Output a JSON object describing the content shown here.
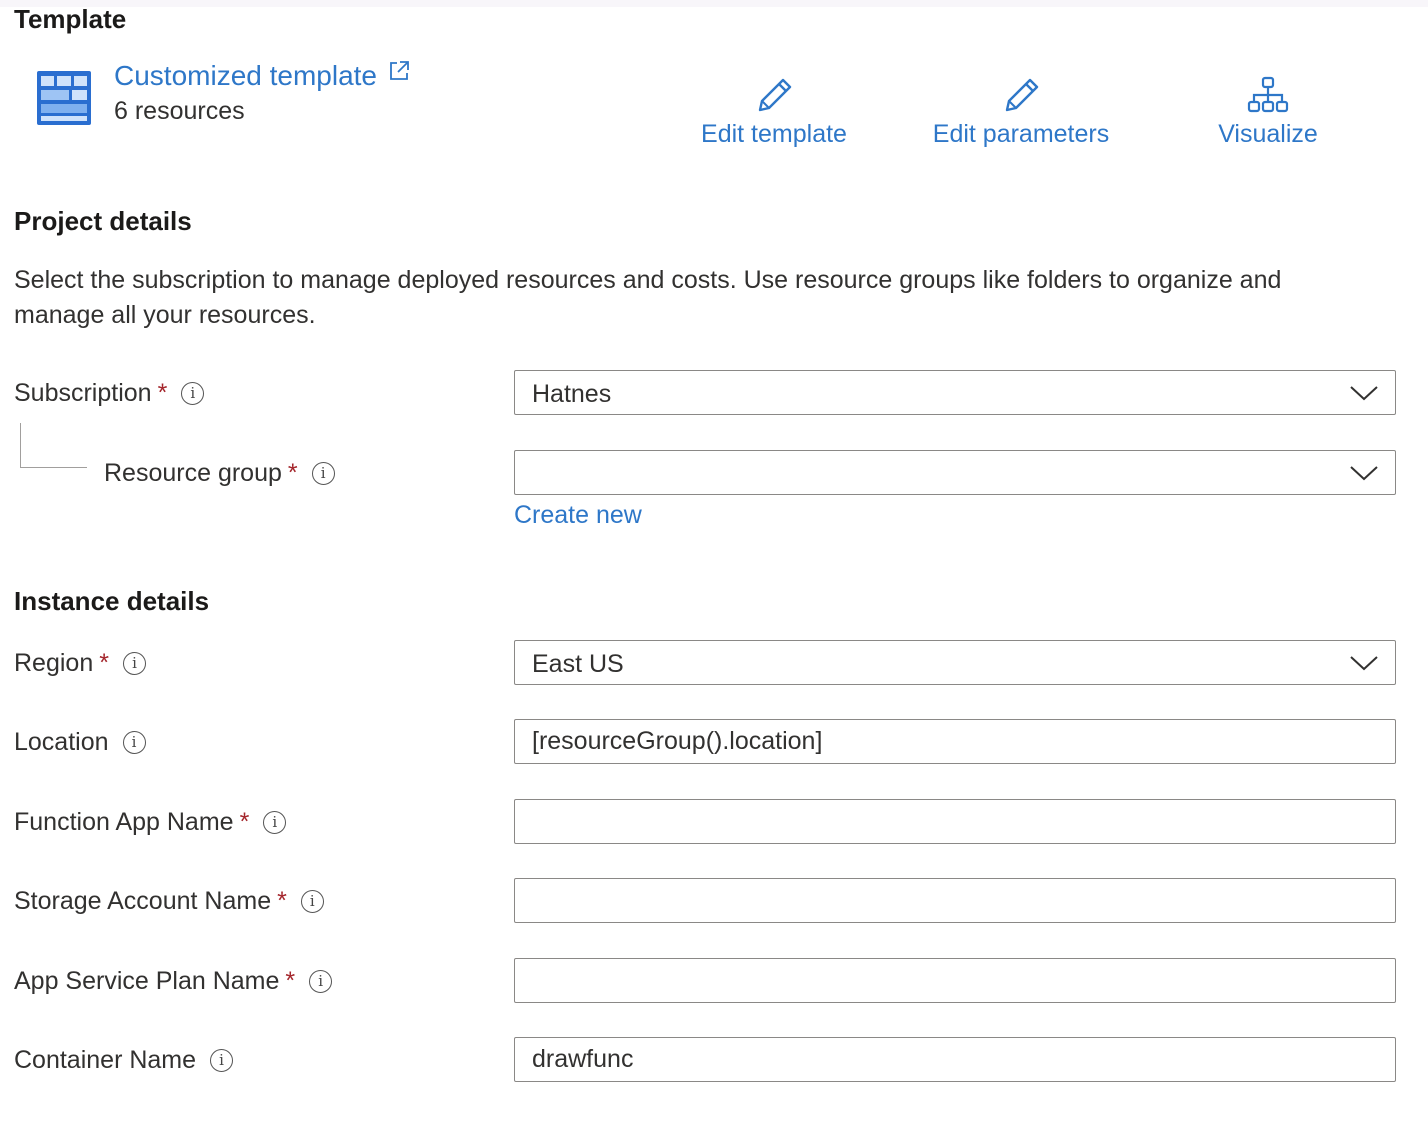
{
  "template": {
    "heading": "Template",
    "name": "Customized template",
    "resources": "6 resources"
  },
  "actions": {
    "edit_template": "Edit template",
    "edit_parameters": "Edit parameters",
    "visualize": "Visualize"
  },
  "project": {
    "heading": "Project details",
    "description_line1": "Select the subscription to manage deployed resources and costs. Use resource groups like folders to organize and",
    "description_line2": "manage all your resources.",
    "subscription_label": "Subscription",
    "subscription_value": "Hatnes",
    "resource_group_label": "Resource group",
    "resource_group_value": "",
    "create_new": "Create new"
  },
  "instance": {
    "heading": "Instance details",
    "region_label": "Region",
    "region_value": "East US",
    "location_label": "Location",
    "location_value": "[resourceGroup().location]",
    "function_app_label": "Function App Name",
    "function_app_value": "",
    "storage_label": "Storage Account Name",
    "storage_value": "",
    "plan_label": "App Service Plan Name",
    "plan_value": "",
    "container_label": "Container Name",
    "container_value": "drawfunc"
  },
  "common": {
    "required_mark": "*",
    "info_glyph": "i"
  },
  "colors": {
    "link": "#2e77c8",
    "required": "#a4262c",
    "border": "#8a8886"
  }
}
